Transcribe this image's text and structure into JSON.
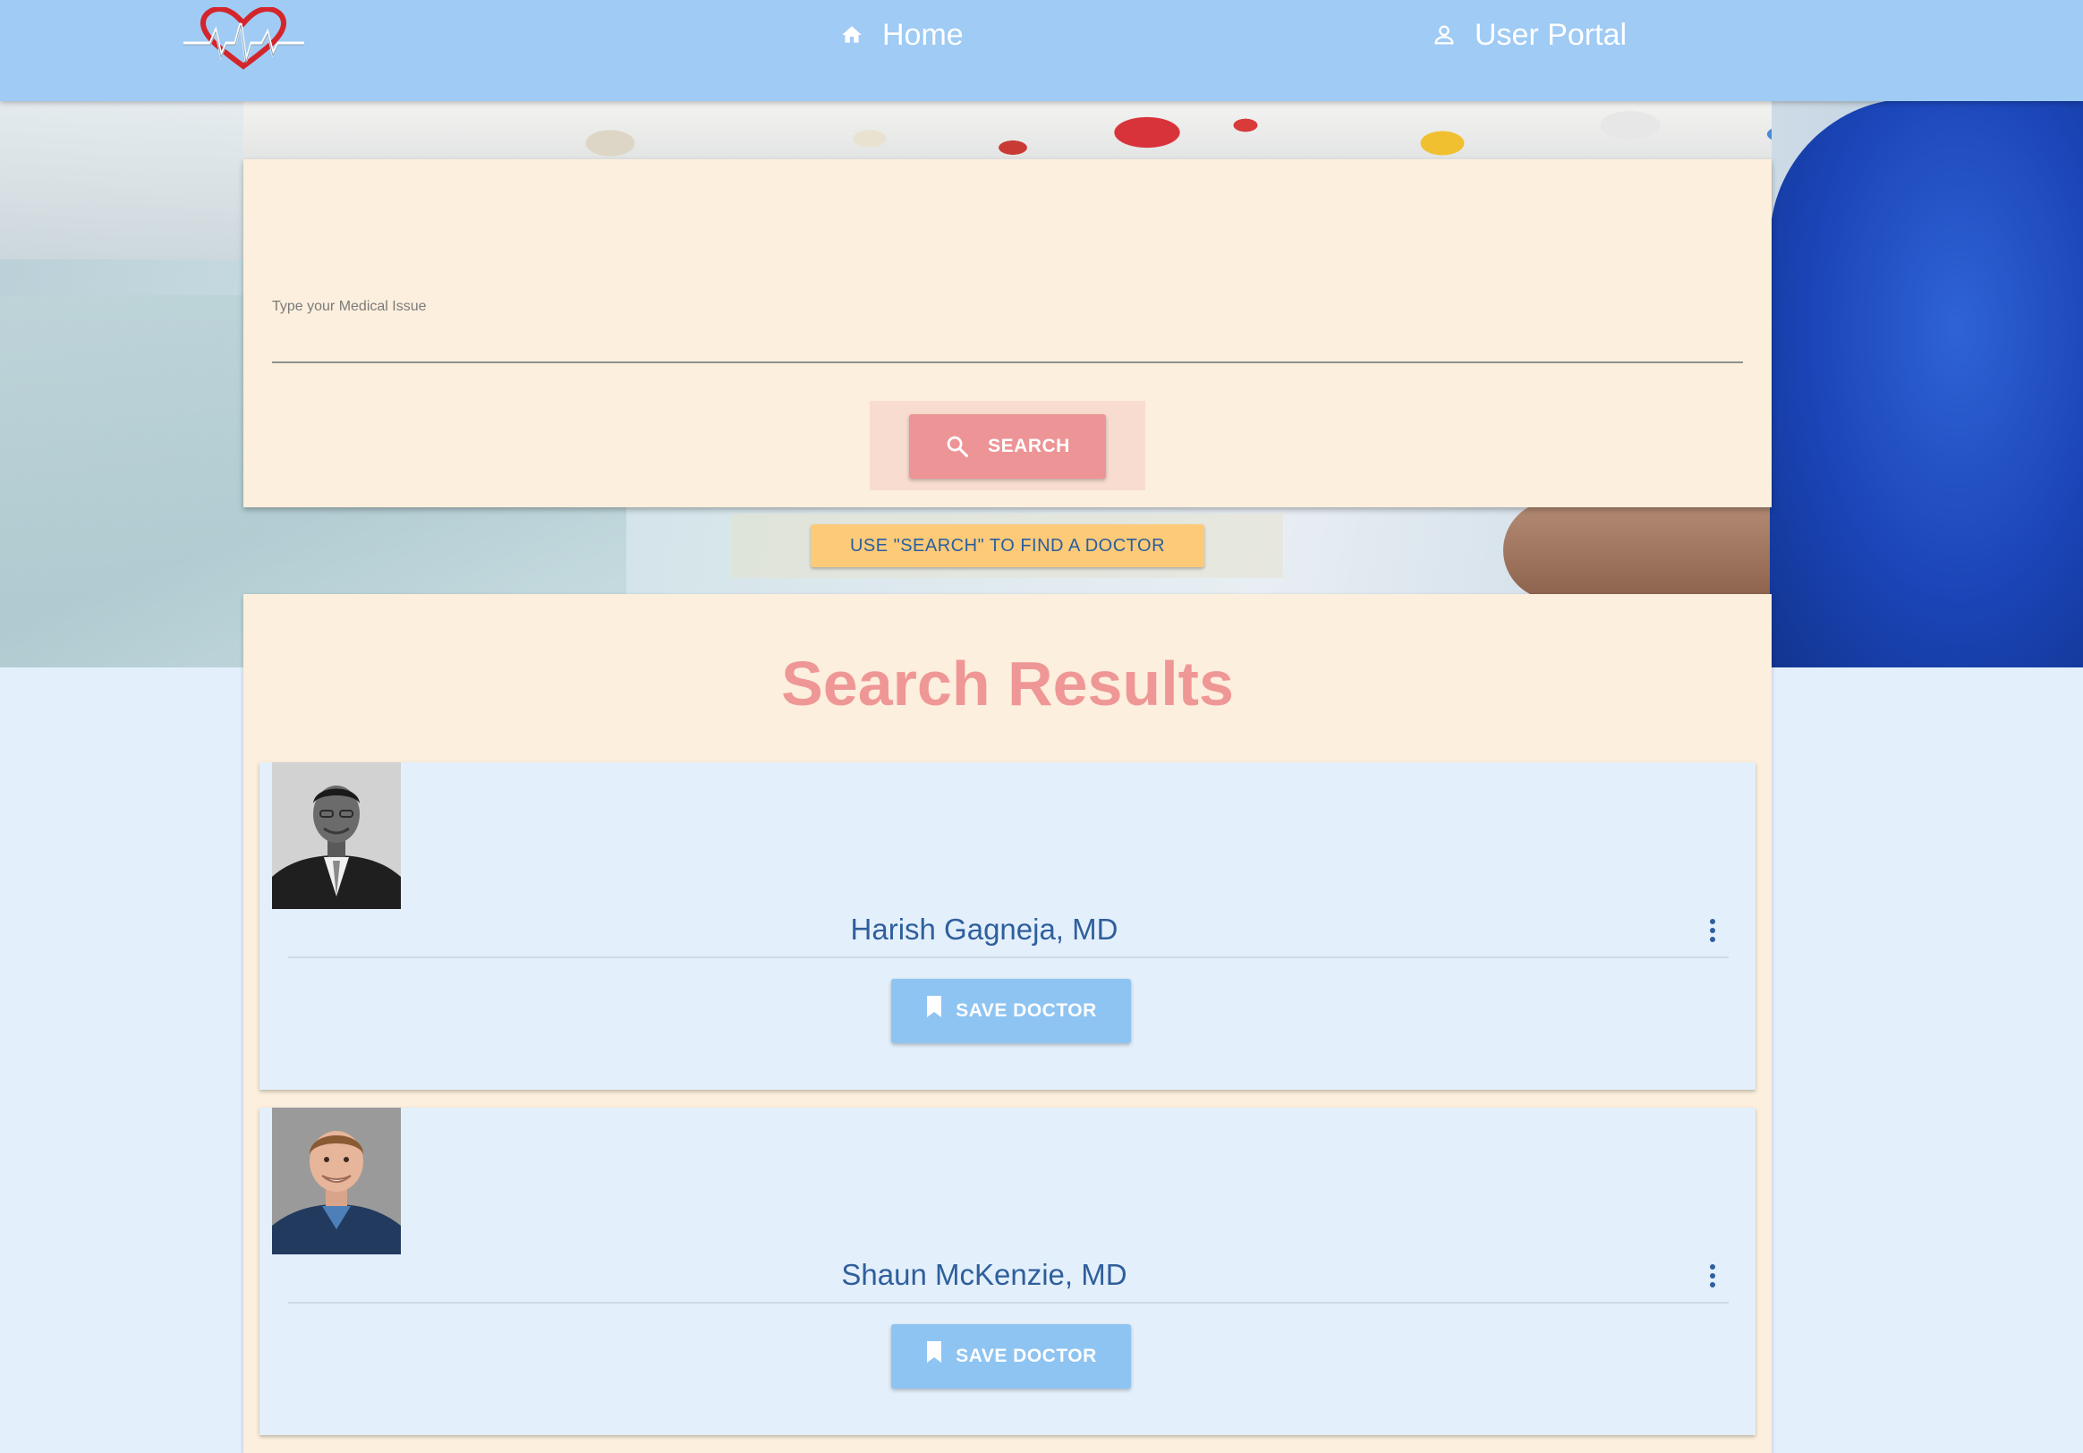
{
  "nav": {
    "home_label": "Home",
    "portal_label": "User Portal"
  },
  "icons": {
    "logo": "heart-pulse-logo",
    "home": "home-icon",
    "portal": "user-icon",
    "search": "search-icon",
    "more": "more-vert-icon",
    "save": "bookmark-icon"
  },
  "search": {
    "label": "Type your Medical Issue",
    "value": "",
    "button_label": "SEARCH",
    "hint_label": "USE \"SEARCH\" TO FIND A DOCTOR"
  },
  "results": {
    "title": "Search Results",
    "doctors": [
      {
        "name": "Harish Gagneja, MD",
        "save_label": "SAVE DOCTOR"
      },
      {
        "name": "Shaun McKenzie, MD",
        "save_label": "SAVE DOCTOR"
      }
    ]
  },
  "colors": {
    "navbar": "#9fcbf4",
    "card_background": "#fcefdd",
    "search_button": "#ed9496",
    "hint_button": "#fdca78",
    "save_button": "#8ec4f2",
    "results_title": "#ef9796",
    "doctor_name": "#2f5f9c"
  }
}
